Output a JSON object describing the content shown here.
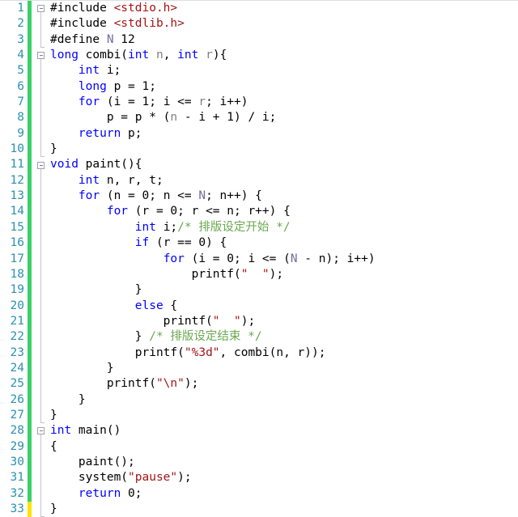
{
  "editor": {
    "language": "C",
    "total_lines": 33,
    "colors": {
      "background": "#ffffff",
      "line_number": "#2b91af",
      "keyword": "#0000ff",
      "string": "#a31515",
      "comment": "#6aa84f",
      "identifier": "#808080",
      "macro": "#6f6f9f",
      "plain_text": "#000000",
      "change_bar_saved": "#3ad06a",
      "change_bar_unsaved": "#ffe300"
    },
    "change_bar": {
      "saved_lines": "1-32",
      "unsaved_lines": "33"
    },
    "fold_marker_lines": [
      1,
      4,
      11,
      28
    ],
    "line_numbers": [
      "1",
      "2",
      "3",
      "4",
      "5",
      "6",
      "7",
      "8",
      "9",
      "10",
      "11",
      "12",
      "13",
      "14",
      "15",
      "16",
      "17",
      "18",
      "19",
      "20",
      "21",
      "22",
      "23",
      "24",
      "25",
      "26",
      "27",
      "28",
      "29",
      "30",
      "31",
      "32",
      "33"
    ],
    "lines": [
      {
        "n": 1,
        "tokens": [
          {
            "t": "#include ",
            "c": "pp"
          },
          {
            "t": "<stdio.h>",
            "c": "str"
          }
        ]
      },
      {
        "n": 2,
        "tokens": [
          {
            "t": "#include ",
            "c": "pp"
          },
          {
            "t": "<stdlib.h>",
            "c": "str"
          }
        ]
      },
      {
        "n": 3,
        "tokens": [
          {
            "t": "#define ",
            "c": "pp"
          },
          {
            "t": "N",
            "c": "mac"
          },
          {
            "t": " 12",
            "c": "pln"
          }
        ]
      },
      {
        "n": 4,
        "tokens": [
          {
            "t": "long",
            "c": "kw"
          },
          {
            "t": " combi(",
            "c": "pln"
          },
          {
            "t": "int",
            "c": "kw"
          },
          {
            "t": " ",
            "c": "pln"
          },
          {
            "t": "n",
            "c": "idn"
          },
          {
            "t": ", ",
            "c": "pln"
          },
          {
            "t": "int",
            "c": "kw"
          },
          {
            "t": " ",
            "c": "pln"
          },
          {
            "t": "r",
            "c": "idn"
          },
          {
            "t": "){",
            "c": "pln"
          }
        ]
      },
      {
        "n": 5,
        "tokens": [
          {
            "t": "    ",
            "c": "pln"
          },
          {
            "t": "int",
            "c": "kw"
          },
          {
            "t": " i;",
            "c": "pln"
          }
        ]
      },
      {
        "n": 6,
        "tokens": [
          {
            "t": "    ",
            "c": "pln"
          },
          {
            "t": "long",
            "c": "kw"
          },
          {
            "t": " p = 1;",
            "c": "pln"
          }
        ]
      },
      {
        "n": 7,
        "tokens": [
          {
            "t": "    ",
            "c": "pln"
          },
          {
            "t": "for",
            "c": "kw"
          },
          {
            "t": " (i = 1; i <= ",
            "c": "pln"
          },
          {
            "t": "r",
            "c": "idn"
          },
          {
            "t": "; i++)",
            "c": "pln"
          }
        ]
      },
      {
        "n": 8,
        "tokens": [
          {
            "t": "        p = p * (",
            "c": "pln"
          },
          {
            "t": "n",
            "c": "idn"
          },
          {
            "t": " - i + 1) / i;",
            "c": "pln"
          }
        ]
      },
      {
        "n": 9,
        "tokens": [
          {
            "t": "    ",
            "c": "pln"
          },
          {
            "t": "return",
            "c": "kw"
          },
          {
            "t": " p;",
            "c": "pln"
          }
        ]
      },
      {
        "n": 10,
        "tokens": [
          {
            "t": "}",
            "c": "pln"
          }
        ]
      },
      {
        "n": 11,
        "tokens": [
          {
            "t": "void",
            "c": "kw"
          },
          {
            "t": " paint(){",
            "c": "pln"
          }
        ]
      },
      {
        "n": 12,
        "tokens": [
          {
            "t": "    ",
            "c": "pln"
          },
          {
            "t": "int",
            "c": "kw"
          },
          {
            "t": " n, r, t;",
            "c": "pln"
          }
        ]
      },
      {
        "n": 13,
        "tokens": [
          {
            "t": "    ",
            "c": "pln"
          },
          {
            "t": "for",
            "c": "kw"
          },
          {
            "t": " (n = 0; n <= ",
            "c": "pln"
          },
          {
            "t": "N",
            "c": "mac"
          },
          {
            "t": "; n++) {",
            "c": "pln"
          }
        ]
      },
      {
        "n": 14,
        "tokens": [
          {
            "t": "        ",
            "c": "pln"
          },
          {
            "t": "for",
            "c": "kw"
          },
          {
            "t": " (r = 0; r <= n; r++) {",
            "c": "pln"
          }
        ]
      },
      {
        "n": 15,
        "tokens": [
          {
            "t": "            ",
            "c": "pln"
          },
          {
            "t": "int",
            "c": "kw"
          },
          {
            "t": " i;",
            "c": "pln"
          },
          {
            "t": "/* 排版设定开始 */",
            "c": "cmt"
          }
        ]
      },
      {
        "n": 16,
        "tokens": [
          {
            "t": "            ",
            "c": "pln"
          },
          {
            "t": "if",
            "c": "kw"
          },
          {
            "t": " (r == 0) {",
            "c": "pln"
          }
        ]
      },
      {
        "n": 17,
        "tokens": [
          {
            "t": "                ",
            "c": "pln"
          },
          {
            "t": "for",
            "c": "kw"
          },
          {
            "t": " (i = 0; i <= (",
            "c": "pln"
          },
          {
            "t": "N",
            "c": "mac"
          },
          {
            "t": " - n); i++)",
            "c": "pln"
          }
        ]
      },
      {
        "n": 18,
        "tokens": [
          {
            "t": "                    printf(",
            "c": "pln"
          },
          {
            "t": "\"  \"",
            "c": "str"
          },
          {
            "t": ");",
            "c": "pln"
          }
        ]
      },
      {
        "n": 19,
        "tokens": [
          {
            "t": "            }",
            "c": "pln"
          }
        ]
      },
      {
        "n": 20,
        "tokens": [
          {
            "t": "            ",
            "c": "pln"
          },
          {
            "t": "else",
            "c": "kw"
          },
          {
            "t": " {",
            "c": "pln"
          }
        ]
      },
      {
        "n": 21,
        "tokens": [
          {
            "t": "                printf(",
            "c": "pln"
          },
          {
            "t": "\"  \"",
            "c": "str"
          },
          {
            "t": ");",
            "c": "pln"
          }
        ]
      },
      {
        "n": 22,
        "tokens": [
          {
            "t": "            } ",
            "c": "pln"
          },
          {
            "t": "/* 排版设定结束 */",
            "c": "cmt"
          }
        ]
      },
      {
        "n": 23,
        "tokens": [
          {
            "t": "            printf(",
            "c": "pln"
          },
          {
            "t": "\"%3d\"",
            "c": "str"
          },
          {
            "t": ", combi(n, r));",
            "c": "pln"
          }
        ]
      },
      {
        "n": 24,
        "tokens": [
          {
            "t": "        }",
            "c": "pln"
          }
        ]
      },
      {
        "n": 25,
        "tokens": [
          {
            "t": "        printf(",
            "c": "pln"
          },
          {
            "t": "\"\\n\"",
            "c": "str"
          },
          {
            "t": ");",
            "c": "pln"
          }
        ]
      },
      {
        "n": 26,
        "tokens": [
          {
            "t": "    }",
            "c": "pln"
          }
        ]
      },
      {
        "n": 27,
        "tokens": [
          {
            "t": "}",
            "c": "pln"
          }
        ]
      },
      {
        "n": 28,
        "tokens": [
          {
            "t": "int",
            "c": "kw"
          },
          {
            "t": " main()",
            "c": "pln"
          }
        ]
      },
      {
        "n": 29,
        "tokens": [
          {
            "t": "{",
            "c": "pln"
          }
        ]
      },
      {
        "n": 30,
        "tokens": [
          {
            "t": "    paint();",
            "c": "pln"
          }
        ]
      },
      {
        "n": 31,
        "tokens": [
          {
            "t": "    system(",
            "c": "pln"
          },
          {
            "t": "\"pause\"",
            "c": "str"
          },
          {
            "t": ");",
            "c": "pln"
          }
        ]
      },
      {
        "n": 32,
        "tokens": [
          {
            "t": "    ",
            "c": "pln"
          },
          {
            "t": "return",
            "c": "kw"
          },
          {
            "t": " 0;",
            "c": "pln"
          }
        ]
      },
      {
        "n": 33,
        "tokens": [
          {
            "t": "}",
            "c": "pln"
          }
        ]
      }
    ]
  }
}
